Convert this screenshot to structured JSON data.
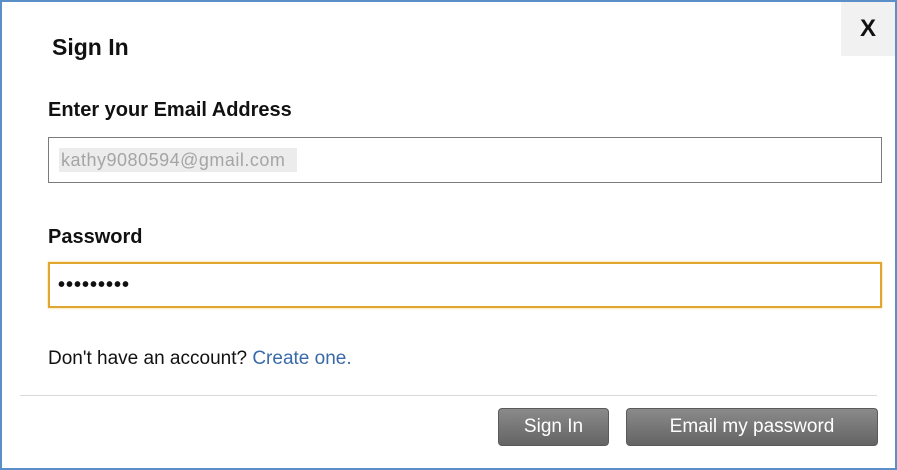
{
  "dialog": {
    "title": "Sign In",
    "close_label": "X",
    "email": {
      "label": "Enter your Email Address",
      "value": "kathy9080594@gmail.com"
    },
    "password": {
      "label": "Password",
      "masked_value": "•••••••••"
    },
    "account_prompt": "Don't have an account?",
    "create_link": "Create one.",
    "buttons": {
      "sign_in": "Sign In",
      "email_password": "Email my password"
    }
  },
  "colors": {
    "dialog_border": "#5b8fc7",
    "focus_border": "#e0a631",
    "link": "#3a6aa8",
    "button_bg": "#737373"
  }
}
